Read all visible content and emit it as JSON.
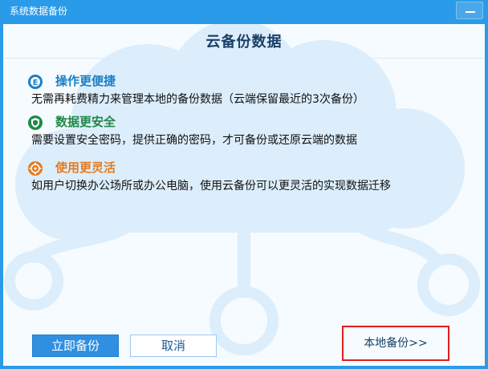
{
  "window": {
    "title": "系统数据备份"
  },
  "header": {
    "title": "云备份数据"
  },
  "features": [
    {
      "title": "操作更便捷",
      "desc": "无需再耗费精力来管理本地的备份数据（云端保留最近的3次备份）",
      "icon": "e-icon",
      "color": "#1a7fc7"
    },
    {
      "title": "数据更安全",
      "desc": "需要设置安全密码，提供正确的密码，才可备份或还原云端的数据",
      "icon": "shield-icon",
      "color": "#1f8a46"
    },
    {
      "title": "使用更灵活",
      "desc": "如用户切换办公场所或办公电脑，使用云备份可以更灵活的实现数据迁移",
      "icon": "flex-icon",
      "color": "#e67a1e"
    }
  ],
  "buttons": {
    "backup_now": "立即备份",
    "cancel": "取消",
    "local_backup": "本地备份>>"
  },
  "colors": {
    "title_bar": "#2a9be8",
    "primary": "#2f8fe0",
    "highlight_box": "#e01e1e"
  }
}
